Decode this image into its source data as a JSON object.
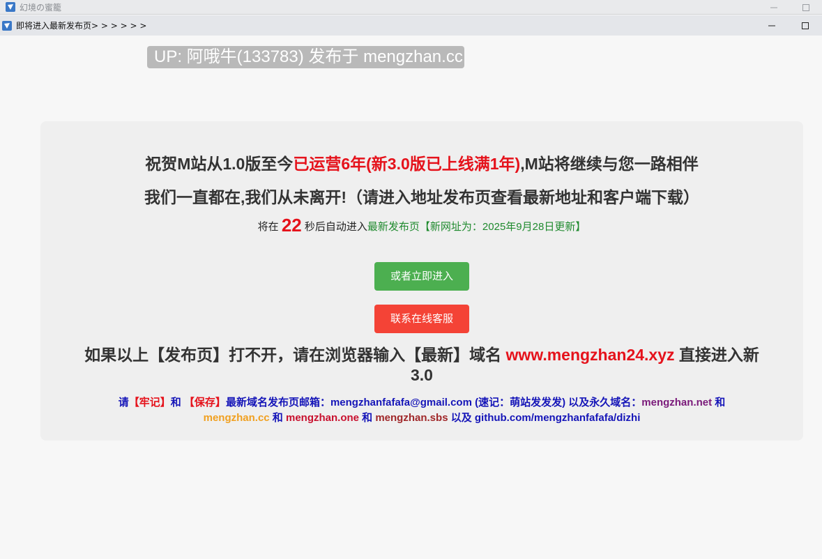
{
  "outer_window": {
    "title": "幻境の蜜籠",
    "minimize_glyph": "—",
    "maximize_glyph": "☐"
  },
  "inner_window": {
    "title": "即将进入最新发布页> > > > > >",
    "minimize_glyph": "—",
    "maximize_glyph": "☐"
  },
  "badge": {
    "text": "UP: 阿哦牛(133783) 发布于 mengzhan.cc"
  },
  "card": {
    "line1_a": "祝贺M站从1.0版至今",
    "line1_b": "已运营6年(新3.0版已上线满1年)",
    "line1_c": ",M站将继续与您一路相伴",
    "line2": "我们一直都在,我们从未离开!（请进入地址发布页查看最新地址和客户端下载）",
    "countdown_prefix": "将在 ",
    "countdown_value": "22",
    "countdown_suffix": " 秒后自动进入",
    "countdown_link": "最新发布页【新网址为：2025年9月28日更新】",
    "enter_button": "或者立即进入",
    "support_button": "联系在线客服",
    "notice_a": "如果以上【发布页】打不开，请在浏览器输入【最新】域名 ",
    "notice_domain": "www.mengzhan24.xyz",
    "notice_b": " 直接进入新3.0",
    "info_please": "请",
    "info_remember": "【牢记】",
    "info_and1": "和 ",
    "info_save": "【保存】",
    "info_email_label": "最新域名发布页邮箱：mengzhanfafafa@gmail.com (速记：萌站发发发) 以及永久域名：",
    "info_domain_net": "mengzhan.net",
    "info_and2": " 和",
    "info_domain_cc": "mengzhan.cc",
    "info_and3": " 和 ",
    "info_domain_one": "mengzhan.one",
    "info_and4": " 和 ",
    "info_domain_sbs": "mengzhan.sbs",
    "info_github": " 以及 github.com/mengzhanfafafa/dizhi"
  },
  "colors": {
    "accent_red": "#e5121b",
    "green_button": "#4caf50",
    "red_button": "#f44336",
    "link_blue": "#1515b8"
  }
}
